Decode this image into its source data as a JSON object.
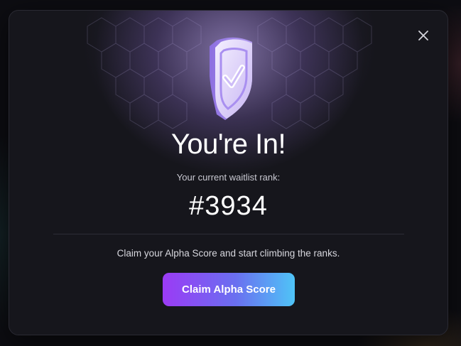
{
  "modal": {
    "title": "You're In!",
    "subtitle": "Your current waitlist rank:",
    "rank": "#3934",
    "message": "Claim your Alpha Score and start climbing the ranks.",
    "cta_label": "Claim Alpha Score",
    "close_icon": "close-icon",
    "hero_icon": "shield-check-icon"
  },
  "colors": {
    "background": "#16161c",
    "text_primary": "#ffffff",
    "text_secondary": "#c9c9d2",
    "cta_gradient_start": "#9b3bf5",
    "cta_gradient_end": "#4fc4f7",
    "glow": "#bea9eb"
  }
}
